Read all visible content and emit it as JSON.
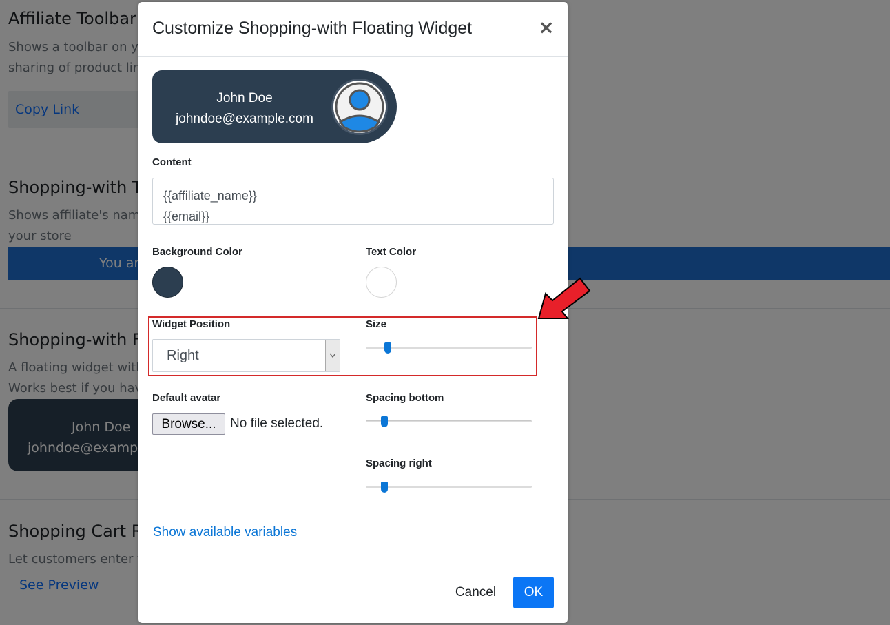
{
  "background": {
    "sections": [
      {
        "title": "Affiliate Toolbar",
        "desc1": "Shows a toolbar on yo",
        "desc2": "sharing of product lin",
        "link": "Copy Link"
      },
      {
        "title": "Shopping-with To",
        "desc1": "Shows affiliate's name",
        "desc2": "your store",
        "bar": "You are"
      },
      {
        "title": "Shopping-with Fl",
        "desc1": "A floating widget with",
        "desc2": "Works best if you hav",
        "widget_name": "John Doe",
        "widget_email": "johndoe@example"
      },
      {
        "title": "Shopping Cart Re",
        "desc1": "Let customers enter th",
        "link": "See Preview"
      }
    ]
  },
  "modal": {
    "title": "Customize Shopping-with Floating Widget",
    "close_label": "×",
    "preview": {
      "name": "John Doe",
      "email": "johndoe@example.com"
    },
    "content_label": "Content",
    "content_lines": [
      "{{affiliate_name}}",
      "{{email}}"
    ],
    "background_color_label": "Background Color",
    "background_color": "#2c3e50",
    "text_color_label": "Text Color",
    "text_color": "#ffffff",
    "widget_position_label": "Widget Position",
    "widget_position_value": "Right",
    "size_label": "Size",
    "size_value": 0.1,
    "default_avatar_label": "Default avatar",
    "browse_label": "Browse...",
    "file_status": "No file selected.",
    "spacing_bottom_label": "Spacing bottom",
    "spacing_bottom_value": 0.08,
    "spacing_right_label": "Spacing right",
    "spacing_right_value": 0.08,
    "variables_link": "Show available variables",
    "cancel_label": "Cancel",
    "ok_label": "OK"
  },
  "colors": {
    "accent": "#0b76f5",
    "highlight": "#d42a2a",
    "arrow": "#e8202a"
  }
}
